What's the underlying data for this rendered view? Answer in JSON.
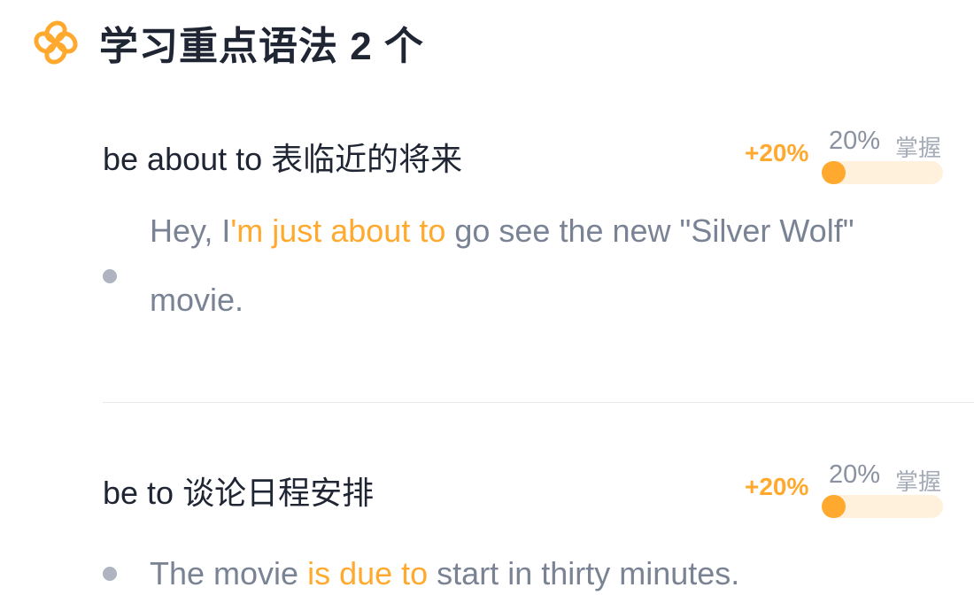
{
  "header": {
    "title": "学习重点语法 2 个",
    "icon": "flower-icon",
    "accent": "#ffa92e"
  },
  "grammar_items": [
    {
      "title": "be about to 表临近的将来",
      "bonus": "+20%",
      "mastery_percent": "20%",
      "mastery_label": "掌握",
      "mastery_fraction": 0.2,
      "example": {
        "before": "Hey, I",
        "highlight": "'m just about to",
        "after": " go see the new \"Silver Wolf\" movie."
      }
    },
    {
      "title": "be to 谈论日程安排",
      "bonus": "+20%",
      "mastery_percent": "20%",
      "mastery_label": "掌握",
      "mastery_fraction": 0.2,
      "example": {
        "before": "The movie ",
        "highlight": "is due to",
        "after": " start in thirty minutes."
      }
    }
  ]
}
